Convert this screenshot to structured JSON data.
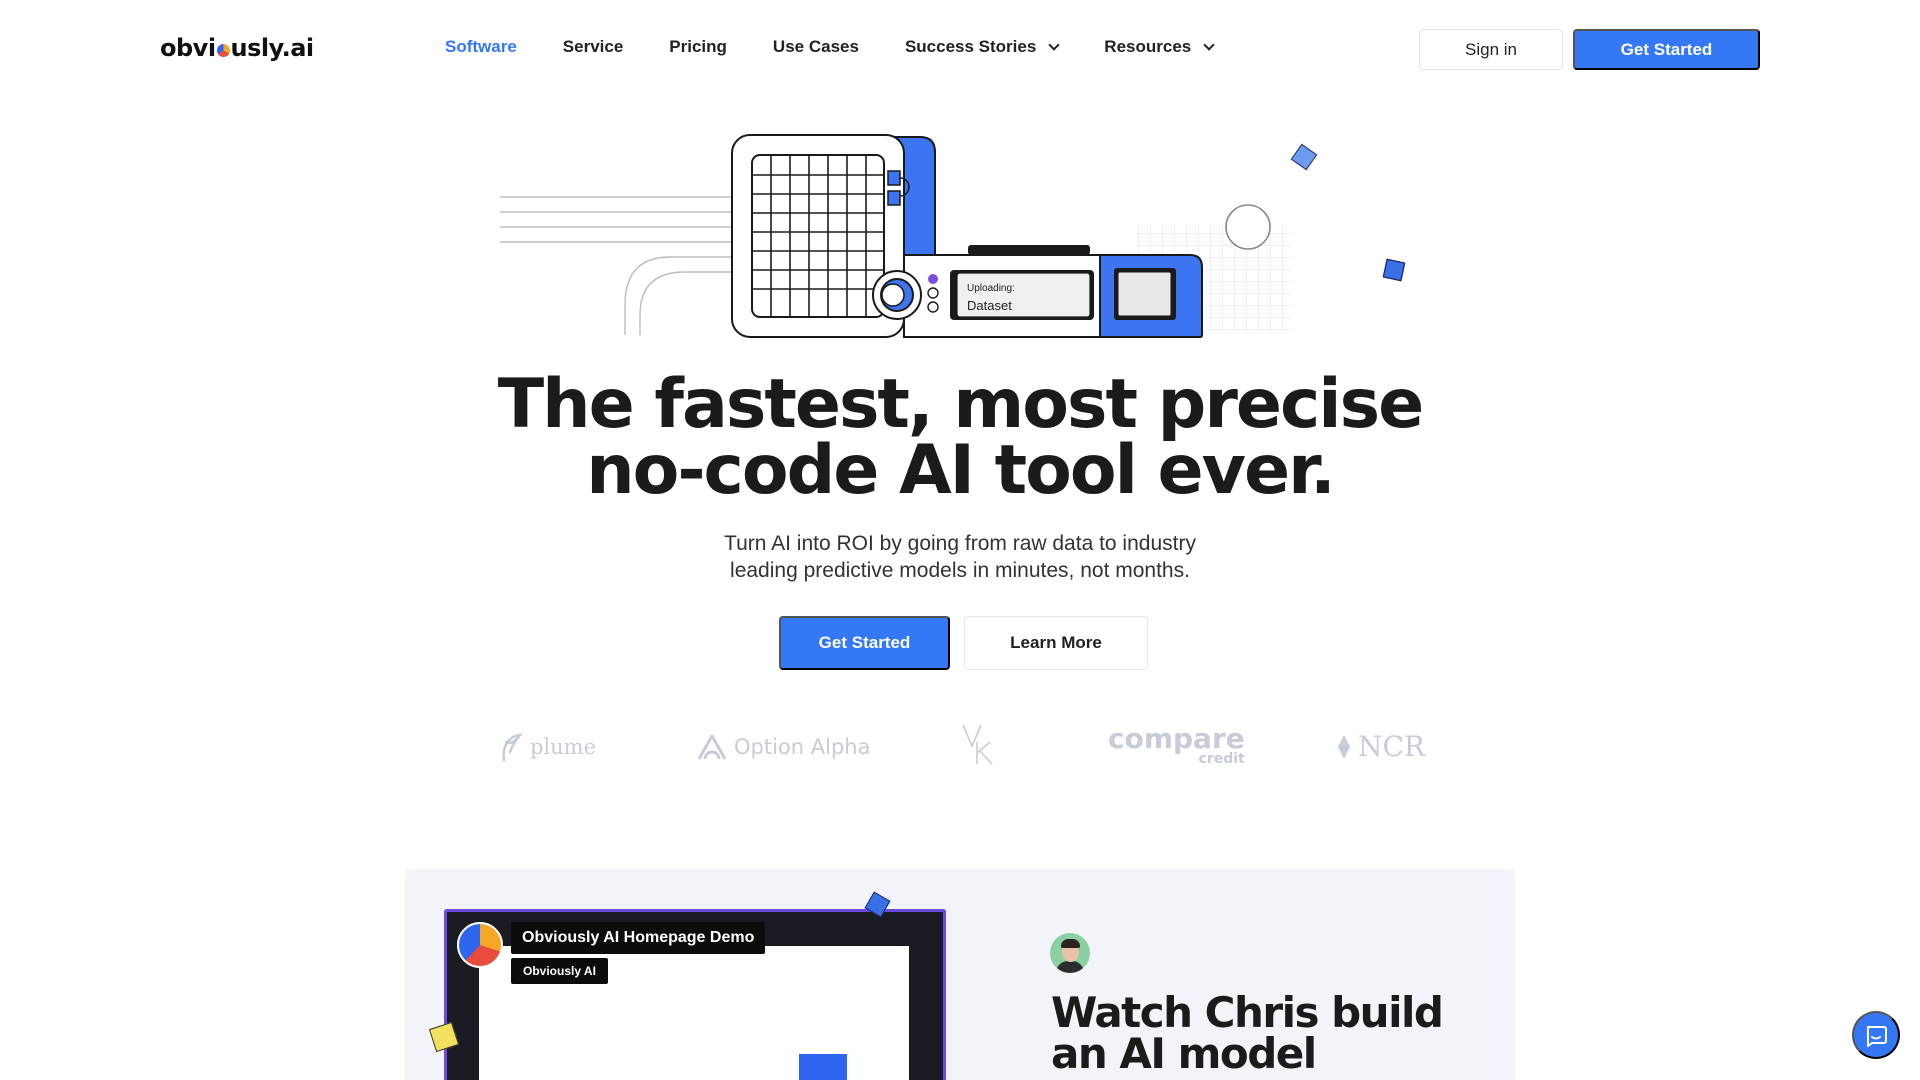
{
  "brand": {
    "name_prefix": "obvi",
    "name_suffix": "usly.ai"
  },
  "nav": {
    "links": [
      {
        "label": "Software",
        "active": true
      },
      {
        "label": "Service"
      },
      {
        "label": "Pricing"
      },
      {
        "label": "Use Cases"
      },
      {
        "label": "Success Stories",
        "dropdown": true
      },
      {
        "label": "Resources",
        "dropdown": true
      }
    ],
    "signin_label": "Sign in",
    "get_started_label": "Get Started"
  },
  "hero": {
    "illustration": {
      "uploading_label": "Uploading:",
      "uploading_value": "Dataset"
    },
    "title_line1": "The fastest, most precise",
    "title_line2": "no-code AI tool ever.",
    "subtitle_line1": "Turn AI into ROI by going from raw data to industry",
    "subtitle_line2": "leading predictive models in minutes, not months.",
    "primary_cta": "Get Started",
    "secondary_cta": "Learn More"
  },
  "customer_logos": {
    "plume": "plume",
    "option_alpha": "Option Alpha",
    "vk": "VK",
    "compare": "compare",
    "compare_sub": "credit",
    "ncr": "NCR"
  },
  "demo": {
    "video_title": "Obviously AI Homepage Demo",
    "video_channel": "Obviously AI",
    "heading_line1": "Watch Chris build",
    "heading_line2": "an AI model"
  },
  "colors": {
    "accent": "#3478f6",
    "text_dark": "#1b1b1b",
    "logo_gray": "#c7ccd8",
    "card_bg": "#f3f4fa",
    "video_border": "#6b4be0"
  },
  "icons": {
    "chevron": "chevron-down-icon",
    "chat": "chat-bubble-icon"
  }
}
